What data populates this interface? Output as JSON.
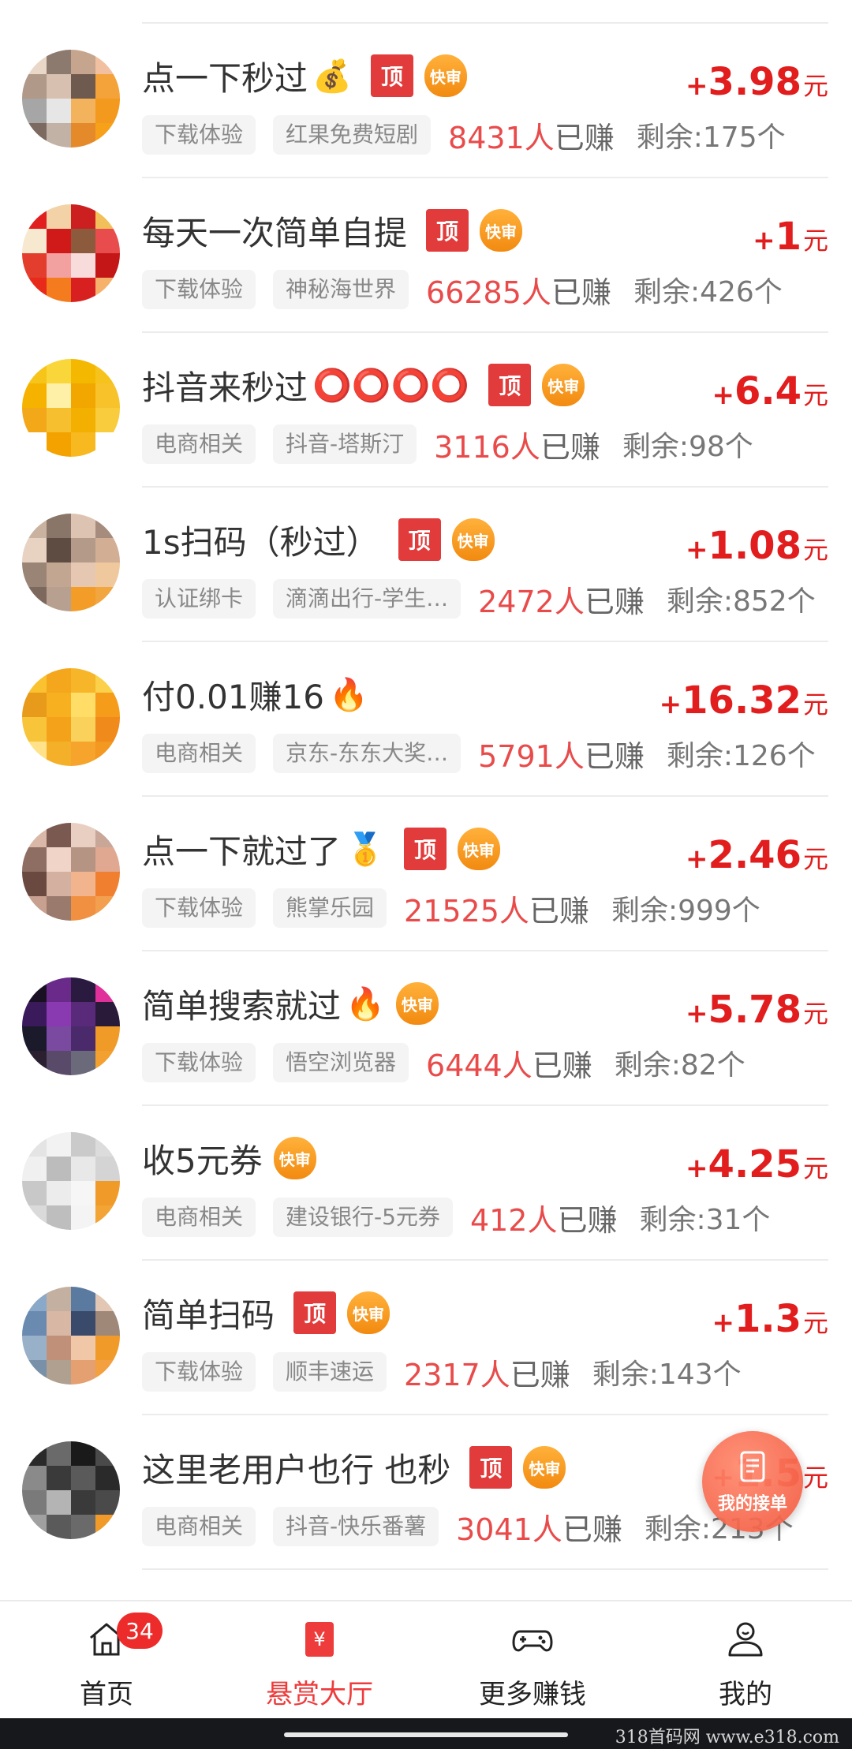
{
  "tasks": [
    {
      "title": "点一下秒过",
      "emoji": "💰",
      "top": "顶",
      "fast": "快审",
      "category": "下载体验",
      "app": "红果免费短剧",
      "earned_count": "8431人",
      "earned_suffix": "已赚",
      "remaining": "剩余:175个",
      "plus": "+",
      "amount": "3.98",
      "unit": "元",
      "avatar_colors": [
        "#e9d8c8",
        "#8c7a6e",
        "#c6a58f",
        "#f0c0a0",
        "#b09988",
        "#d8c0b0",
        "#6e5a4e",
        "#f4a23a",
        "#a6a6a6",
        "#e6e6e6",
        "#f2b35c",
        "#f39a1e",
        "#7c6a60",
        "#c2b2a6",
        "#e58a2a",
        "#f7a11b"
      ]
    },
    {
      "title": "每天一次简单自提",
      "emoji": "",
      "top": "顶",
      "fast": "快审",
      "category": "下载体验",
      "app": "神秘海世界",
      "earned_count": "66285人",
      "earned_suffix": "已赚",
      "remaining": "剩余:426个",
      "plus": "+",
      "amount": "1",
      "unit": "元",
      "avatar_colors": [
        "#e21f1f",
        "#f3d2a8",
        "#cc2020",
        "#f2c05b",
        "#f7e9d0",
        "#d01a1a",
        "#8c5a3c",
        "#e84c4c",
        "#e23d2d",
        "#f2a0a0",
        "#f8dcdc",
        "#c41616",
        "#e82a1a",
        "#f57c1e",
        "#d92020",
        "#f6b16a"
      ]
    },
    {
      "title": "抖音来秒过",
      "emoji": "⭕⭕⭕⭕",
      "top": "顶",
      "fast": "快审",
      "category": "电商相关",
      "app": "抖音-塔斯汀",
      "earned_count": "3116人",
      "earned_suffix": "已赚",
      "remaining": "剩余:98个",
      "plus": "+",
      "amount": "6.4",
      "unit": "元",
      "avatar_colors": [
        "#f7c51a",
        "#f9d63a",
        "#f4b800",
        "#f6c21c",
        "#f5b300",
        "#fff0a8",
        "#f2a600",
        "#f7c22a",
        "#f3a81a",
        "#f6bf30",
        "#f4b000",
        "#f8cc3c",
        "#ffffff",
        "#f3a200",
        "#f7b820",
        "#ffffff"
      ]
    },
    {
      "title": "1s扫码（秒过）",
      "emoji": "",
      "top": "顶",
      "fast": "快审",
      "category": "认证绑卡",
      "app": "滴滴出行-学生…",
      "earned_count": "2472人",
      "earned_suffix": "已赚",
      "remaining": "剩余:852个",
      "plus": "+",
      "amount": "1.08",
      "unit": "元",
      "avatar_colors": [
        "#c9b2a0",
        "#8a7668",
        "#ddc4b2",
        "#a58c7c",
        "#e8d2c2",
        "#5e4c42",
        "#b49a88",
        "#d2ae94",
        "#9a8476",
        "#c2a692",
        "#e6c8b2",
        "#f0c89e",
        "#7c685c",
        "#b8a090",
        "#f39c28",
        "#f2a640"
      ]
    },
    {
      "title": "付0.01赚16",
      "emoji": "🔥",
      "top": "",
      "fast": "",
      "category": "电商相关",
      "app": "京东-东东大奖…",
      "earned_count": "5791人",
      "earned_suffix": "已赚",
      "remaining": "剩余:126个",
      "plus": "+",
      "amount": "16.32",
      "unit": "元",
      "avatar_colors": [
        "#f9c22e",
        "#f4a71c",
        "#f7b62a",
        "#fbd04a",
        "#e89a1a",
        "#f6b020",
        "#ffdd66",
        "#f59c1a",
        "#f7c43a",
        "#f3a21a",
        "#fad15a",
        "#f08a1a",
        "#ffe28a",
        "#f5b02a",
        "#f6a42c",
        "#f39820"
      ]
    },
    {
      "title": "点一下就过了",
      "emoji": "🥇",
      "top": "顶",
      "fast": "快审",
      "category": "下载体验",
      "app": "熊掌乐园",
      "earned_count": "21525人",
      "earned_suffix": "已赚",
      "remaining": "剩余:999个",
      "plus": "+",
      "amount": "2.46",
      "unit": "元",
      "avatar_colors": [
        "#d9b8a8",
        "#7a5a50",
        "#e8cfc2",
        "#c8a698",
        "#8e6e62",
        "#f0d4c8",
        "#b69484",
        "#e0a890",
        "#6a4a40",
        "#d4b0a0",
        "#f2b48c",
        "#f08030",
        "#c8a090",
        "#9a7a6c",
        "#f09040",
        "#f2a050"
      ]
    },
    {
      "title": "简单搜索就过",
      "emoji": "🔥",
      "top": "",
      "fast": "快审",
      "category": "下载体验",
      "app": "悟空浏览器",
      "earned_count": "6444人",
      "earned_suffix": "已赚",
      "remaining": "剩余:82个",
      "plus": "+",
      "amount": "5.78",
      "unit": "元",
      "avatar_colors": [
        "#1a1024",
        "#6a2a8a",
        "#2a1a40",
        "#e0309a",
        "#3a1a5a",
        "#8a3ab0",
        "#5a2a7a",
        "#2a1a3a",
        "#1a1a2a",
        "#7a4aa0",
        "#4a2a6a",
        "#f09a28",
        "#2a2030",
        "#5a4a6a",
        "#6a6a7a",
        "#f2a030"
      ]
    },
    {
      "title": "收5元券",
      "emoji": "",
      "top": "",
      "fast": "快审",
      "category": "电商相关",
      "app": "建设银行-5元券",
      "earned_count": "412人",
      "earned_suffix": "已赚",
      "remaining": "剩余:31个",
      "plus": "+",
      "amount": "4.25",
      "unit": "元",
      "avatar_colors": [
        "#e4e4e4",
        "#f2f2f2",
        "#cacaca",
        "#dcdcdc",
        "#f0f0f0",
        "#bcbcbc",
        "#e8e8e8",
        "#d4d4d4",
        "#c8c8c8",
        "#ececec",
        "#f6f6f6",
        "#f09a2a",
        "#dadada",
        "#bebebe",
        "#f4f4f4",
        "#f2a434"
      ]
    },
    {
      "title": "简单扫码",
      "emoji": "",
      "top": "顶",
      "fast": "快审",
      "category": "下载体验",
      "app": "顺丰速运",
      "earned_count": "2317人",
      "earned_suffix": "已赚",
      "remaining": "剩余:143个",
      "plus": "+",
      "amount": "1.3",
      "unit": "元",
      "avatar_colors": [
        "#8aa8c8",
        "#c4b0a0",
        "#5a7aa0",
        "#e2c8b4",
        "#6a8ab0",
        "#d8b8a4",
        "#3a4a6a",
        "#a08878",
        "#98b0c8",
        "#c09078",
        "#f0c8a8",
        "#f09a2a",
        "#7890a8",
        "#b0a090",
        "#e4a070",
        "#f2a040"
      ]
    },
    {
      "title": "这里老用户也行 也秒",
      "emoji": "",
      "top": "顶",
      "fast": "快审",
      "category": "电商相关",
      "app": "抖音-快乐番薯",
      "earned_count": "3041人",
      "earned_suffix": "已赚",
      "remaining": "剩余:213个",
      "plus": "+",
      "amount": "1.5",
      "unit": "元",
      "avatar_colors": [
        "#2a2a2a",
        "#6a6a6a",
        "#1a1a1a",
        "#4a4a4a",
        "#8a8a8a",
        "#3a3a3a",
        "#5a5a5a",
        "#2a2a2a",
        "#7a7a7a",
        "#b4b4b4",
        "#3a3a3a",
        "#4a4a4a",
        "#a0a0a0",
        "#5a5a5a",
        "#6a6a6a",
        "#f09a2a"
      ]
    }
  ],
  "float_button": {
    "label": "我的接单"
  },
  "tab_bar": {
    "tabs": [
      {
        "label": "首页",
        "icon": "home-icon",
        "badge": "34"
      },
      {
        "label": "悬赏大厅",
        "icon": "bounty-hall-icon",
        "badge": ""
      },
      {
        "label": "更多赚钱",
        "icon": "gamepad-icon",
        "badge": ""
      },
      {
        "label": "我的",
        "icon": "profile-icon",
        "badge": ""
      }
    ],
    "active_color": "#ee3b3b"
  },
  "watermark": "318首码网 www.e318.com",
  "colors": {
    "reward": "#e11d1d",
    "top_badge": "#e23b3b",
    "fast_badge": "#f28a10",
    "earned": "#e94b4b"
  }
}
